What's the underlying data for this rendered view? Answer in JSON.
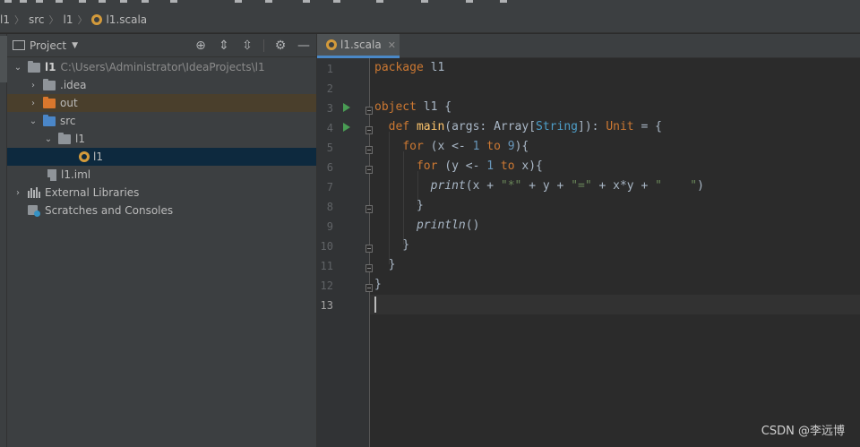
{
  "breadcrumb": {
    "items": [
      "l1",
      "src",
      "l1",
      "l1.scala"
    ]
  },
  "project_panel": {
    "title": "Project",
    "tree": [
      {
        "label": "l1",
        "path": "C:\\Users\\Administrator\\IdeaProjects\\l1"
      },
      {
        "label": ".idea"
      },
      {
        "label": "out"
      },
      {
        "label": "src"
      },
      {
        "label": "l1"
      },
      {
        "label": "l1"
      },
      {
        "label": "l1.iml"
      },
      {
        "label": "External Libraries"
      },
      {
        "label": "Scratches and Consoles"
      }
    ],
    "header_icons": [
      "locate-icon",
      "expand-all-icon",
      "collapse-all-icon",
      "settings-icon",
      "hide-icon"
    ]
  },
  "editor": {
    "tab_label": "l1.scala",
    "current_line": 13,
    "line_numbers": [
      "1",
      "2",
      "3",
      "4",
      "5",
      "6",
      "7",
      "8",
      "9",
      "10",
      "11",
      "12",
      "13"
    ],
    "lines": [
      "package l1",
      "",
      "object l1 {",
      "  def main(args: Array[String]): Unit = {",
      "    for (x <- 1 to 9){",
      "      for (y <- 1 to x){",
      "        print(x + \"*\" + y + \"=\" + x*y + \"    \")",
      "      }",
      "      println()",
      "    }",
      "  }",
      "}",
      ""
    ]
  },
  "colors": {
    "keyword": "#cc7832",
    "function": "#ffc66d",
    "number": "#6897bb",
    "string": "#6a8759",
    "type": "#4e9ec8",
    "text": "#a9b7c6",
    "run_icon": "#499c54"
  },
  "watermark": "CSDN @李远博"
}
